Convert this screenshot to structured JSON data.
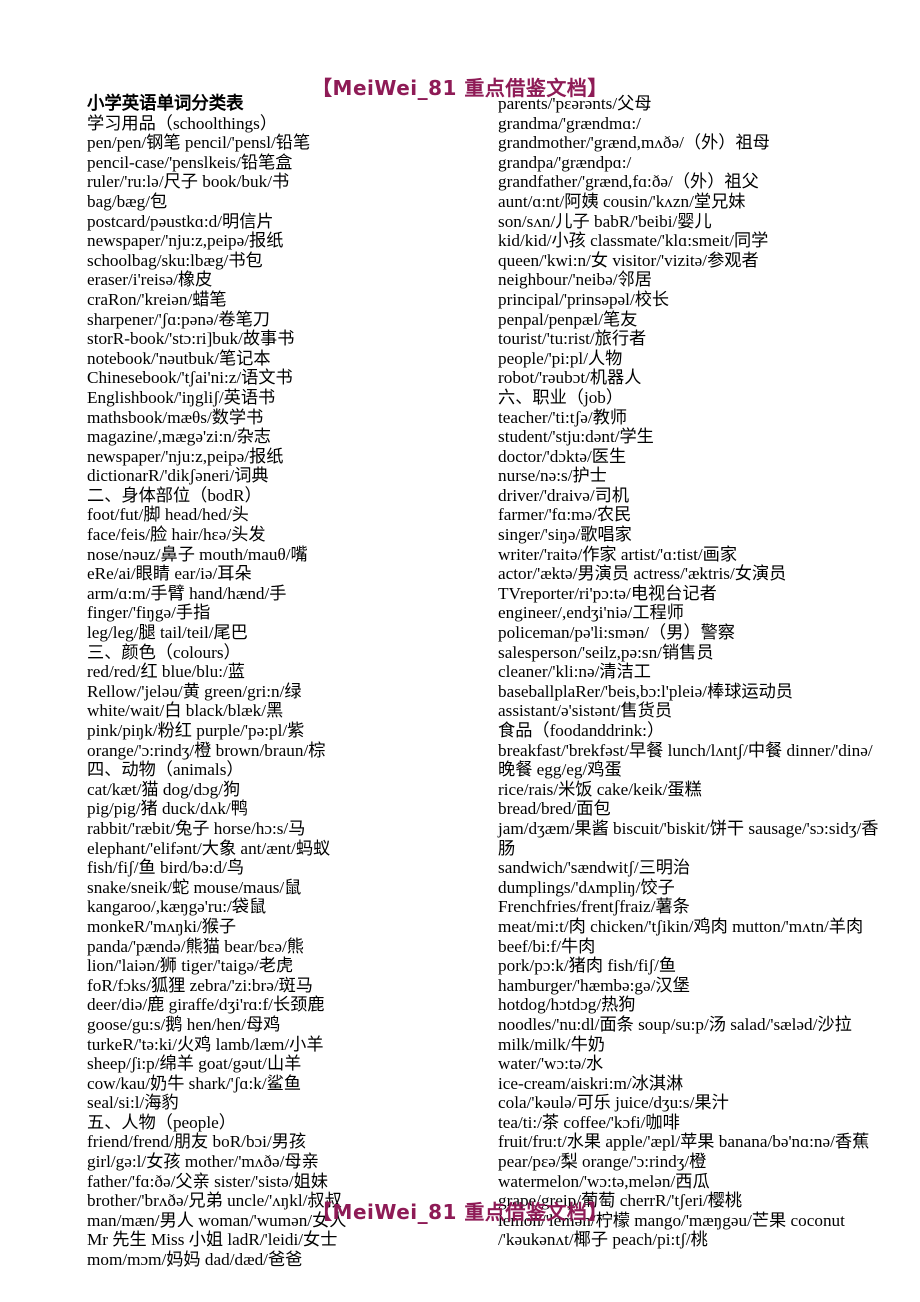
{
  "document": {
    "watermark_top": "【MeiWei_81 重点借鉴文档】",
    "watermark_bottom": "【MeiWei_81 重点借鉴文档】",
    "watermark_color": "#8e1b56",
    "title": "小学英语单词分类表"
  },
  "left_column": {
    "lines": [
      "小学英语单词分类表",
      "学习用品（schoolthings）",
      "pen/pen/钢笔 pencil/'pensl/铅笔",
      "pencil-case/'penslkeis/铅笔盒",
      "ruler/'ru:lə/尺子 book/buk/书",
      "bag/bæg/包",
      "postcard/pəustkɑ:d/明信片",
      "newspaper/'nju:z,peipə/报纸",
      "schoolbag/sku:lbæg/书包",
      "eraser/i'reisə/橡皮",
      "craRon/'kreiən/蜡笔",
      "sharpener/'ʃɑ:pənə/卷笔刀",
      "storR-book/'stɔ:ri]buk/故事书",
      "notebook/'nəutbuk/笔记本",
      "Chinesebook/'tʃai'ni:z/语文书",
      "Englishbook/'iŋgliʃ/英语书",
      "mathsbook/mæθs/数学书",
      "magazine/,mægə'zi:n/杂志",
      "newspaper/'nju:z,peipə/报纸",
      "dictionarR/'dikʃəneri/词典",
      "二、身体部位（bodR）",
      "foot/fut/脚 head/hed/头",
      "face/feis/脸 hair/hɛə/头发",
      "nose/nəuz/鼻子 mouth/mauθ/嘴",
      "eRe/ai/眼睛 ear/iə/耳朵",
      "arm/ɑ:m/手臂 hand/hænd/手",
      "finger/'fiŋgə/手指",
      "leg/leg/腿 tail/teil/尾巴",
      "三、颜色（colours）",
      "red/red/红 blue/blu:/蓝",
      "Rellow/'jeləu/黄 green/gri:n/绿",
      "white/wait/白 black/blæk/黑",
      "pink/piŋk/粉红 purple/'pə:pl/紫",
      "orange/'ɔ:rindʒ/橙 brown/braun/棕",
      "四、动物（animals）",
      "cat/kæt/猫 dog/dɔg/狗",
      "pig/pig/猪 duck/dʌk/鸭",
      "rabbit/'ræbit/兔子 horse/hɔ:s/马",
      "elephant/'elifənt/大象 ant/ænt/蚂蚁",
      "fish/fiʃ/鱼 bird/bə:d/鸟",
      "snake/sneik/蛇 mouse/maus/鼠",
      "kangaroo/,kæŋgə'ru:/袋鼠",
      "monkeR/'mʌŋki/猴子",
      "panda/'pændə/熊猫 bear/bɛə/熊",
      "lion/'laiən/狮 tiger/'taigə/老虎",
      "foR/fɔks/狐狸 zebra/'zi:brə/斑马",
      "deer/diə/鹿 giraffe/dʒi'rɑ:f/长颈鹿",
      "goose/gu:s/鹅 hen/hen/母鸡",
      "turkeR/'tə:ki/火鸡 lamb/læm/小羊",
      "sheep/ʃi:p/绵羊 goat/gəut/山羊",
      "cow/kau/奶牛 shark/'ʃɑ:k/鲨鱼",
      "seal/si:l/海豹",
      "五、人物（people）",
      "friend/frend/朋友 boR/bɔi/男孩",
      "girl/gə:l/女孩 mother/'mʌðə/母亲",
      "father/'fɑ:ðə/父亲 sister/'sistə/姐妹",
      "brother/'brʌðə/兄弟 uncle/'ʌŋkl/叔叔",
      "man/mæn/男人 woman/'wumən/女人",
      "Mr 先生 Miss 小姐 ladR/'leidi/女士",
      "mom/mɔm/妈妈 dad/dæd/爸爸"
    ]
  },
  "right_column": {
    "lines": [
      "parents/'pɛərənts/父母",
      "grandma/'grændmɑ:/",
      "grandmother/'grænd,mʌðə/（外）祖母",
      "grandpa/'grændpɑ:/",
      "grandfather/'grænd,fɑ:ðə/（外）祖父",
      "aunt/ɑ:nt/阿姨 cousin/'kʌzn/堂兄妹",
      "son/sʌn/儿子 babR/'beibi/婴儿",
      "kid/kid/小孩 classmate/'klɑ:smeit/同学",
      "queen/'kwi:n/女 visitor/'vizitə/参观者",
      "neighbour/'neibə/邻居",
      "principal/'prinsəpəl/校长",
      "penpal/penpæl/笔友",
      "tourist/'tu:rist/旅行者",
      "people/'pi:pl/人物",
      "robot/'rəubɔt/机器人",
      "六、职业（job）",
      "teacher/'ti:tʃə/教师",
      "student/'stju:dənt/学生",
      "doctor/'dɔktə/医生",
      "nurse/nə:s/护士",
      "driver/'draivə/司机",
      "farmer/'fɑ:mə/农民",
      "singer/'siŋə/歌唱家",
      "writer/'raitə/作家 artist/'ɑ:tist/画家",
      "actor/'æktə/男演员 actress/'æktris/女演员",
      "TVreporter/ri'pɔ:tə/电视台记者",
      "engineer/,endʒi'niə/工程师",
      "policeman/pə'li:smən/（男）警察",
      "salesperson/'seilz,pə:sn/销售员",
      "cleaner/'kli:nə/清洁工",
      "baseballplaRer/'beis,bɔ:l'pleiə/棒球运动员",
      "assistant/ə'sistənt/售货员",
      "食品（foodanddrink:）",
      "breakfast/'brekfəst/早餐 lunch/lʌntʃ/中餐 dinner/'dinə/晚餐 egg/eg/鸡蛋",
      "rice/rais/米饭 cake/keik/蛋糕",
      "bread/bred/面包",
      "jam/dʒæm/果酱 biscuit/'biskit/饼干 sausage/'sɔ:sidʒ/香肠",
      "sandwich/'sændwitʃ/三明治",
      "dumplings/'dʌmpliŋ/饺子",
      "Frenchfries/frentʃfraiz/薯条",
      "meat/mi:t/肉 chicken/'tʃikin/鸡肉 mutton/'mʌtn/羊肉 beef/bi:f/牛肉",
      "pork/pɔ:k/猪肉 fish/fiʃ/鱼",
      "hamburger/'hæmbə:gə/汉堡",
      "hotdog/hɔtdɔg/热狗",
      "noodles/'nu:dl/面条 soup/su:p/汤 salad/'sæləd/沙拉 milk/milk/牛奶",
      "water/'wɔ:tə/水",
      "ice-cream/aiskri:m/冰淇淋",
      "cola/'kəulə/可乐 juice/dʒu:s/果汁",
      "tea/ti:/茶 coffee/'kɔfi/咖啡",
      "fruit/fru:t/水果 apple/'æpl/苹果 banana/bə'nɑ:nə/香蕉",
      "pear/pɛə/梨 orange/'ɔ:rindʒ/橙 watermelon/'wɔ:tə,melən/西瓜",
      "grape/greip/葡萄 cherrR/'tʃeri/樱桃",
      "lemon/'lemən/柠檬 mango/'mæŋgəu/芒果 coconut /'kəukənʌt/椰子 peach/pi:tʃ/桃"
    ]
  }
}
